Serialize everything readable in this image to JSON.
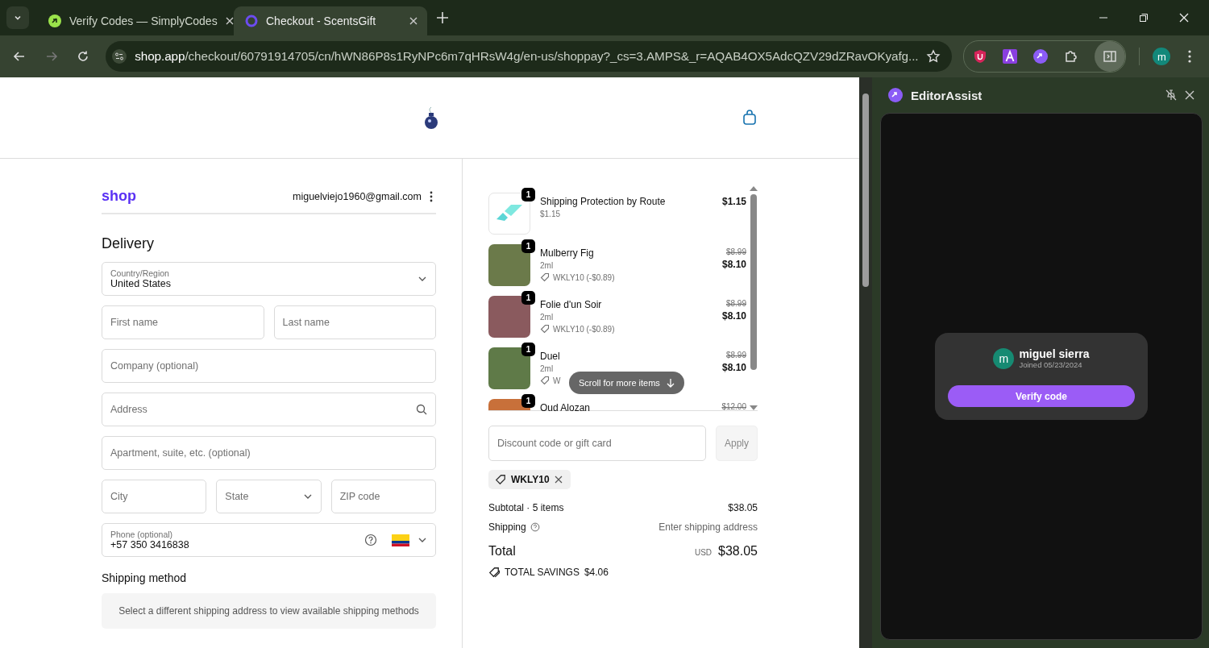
{
  "browser": {
    "tabs": [
      {
        "title": "Verify Codes — SimplyCodes",
        "selected": false
      },
      {
        "title": "Checkout - ScentsGift",
        "selected": true
      }
    ],
    "address": {
      "domain": "shop.app",
      "path": "/checkout/60791914705/cn/hWN86P8s1RyNPc6m7qHRsW4g/en-us/shoppay?_cs=3.AMPS&_r=AQAB4OX5AdcQZV29dZRavOKyafg..."
    },
    "profile_initial": "m"
  },
  "account": {
    "brand": "shop",
    "email": "miguelviejo1960@gmail.com"
  },
  "delivery": {
    "title": "Delivery",
    "rows": [
      [
        {
          "kind": "select",
          "label": "Country/Region",
          "value": "United States"
        }
      ],
      [
        {
          "kind": "text",
          "placeholder": "First name"
        },
        {
          "kind": "text",
          "placeholder": "Last name"
        }
      ],
      [
        {
          "kind": "text",
          "placeholder": "Company (optional)"
        }
      ],
      [
        {
          "kind": "search",
          "placeholder": "Address"
        }
      ],
      [
        {
          "kind": "text",
          "placeholder": "Apartment, suite, etc. (optional)"
        }
      ],
      [
        {
          "kind": "text",
          "placeholder": "City"
        },
        {
          "kind": "dropdown",
          "placeholder": "State"
        },
        {
          "kind": "text",
          "placeholder": "ZIP code"
        }
      ],
      [
        {
          "kind": "phone",
          "label": "Phone (optional)",
          "value": "+57 350 3416838"
        }
      ]
    ],
    "shipping_method": {
      "title": "Shipping method",
      "message": "Select a different shipping address to view available shipping methods"
    }
  },
  "cart": {
    "items": [
      {
        "kind": "route",
        "quantity": "1",
        "name": "Shipping Protection by Route",
        "subtitle": "$1.15",
        "price": "$1.15"
      },
      {
        "kind": "product",
        "quantity": "1",
        "name": "Mulberry Fig",
        "subtitle": "2ml",
        "discount": "WKLY10 (-$0.89)",
        "old_price": "$8.99",
        "price": "$8.10",
        "color": "#6b7a4a"
      },
      {
        "kind": "product",
        "quantity": "1",
        "name": "Folie d'un Soir",
        "subtitle": "2ml",
        "discount": "WKLY10 (-$0.89)",
        "old_price": "$8.99",
        "price": "$8.10",
        "color": "#8a5a5e"
      },
      {
        "kind": "product",
        "quantity": "1",
        "name": "Duel",
        "subtitle": "2ml",
        "discount": "W",
        "old_price": "$8.99",
        "price": "$8.10",
        "color": "#5f7a48"
      },
      {
        "kind": "product",
        "quantity": "1",
        "name": "Oud Alozan",
        "old_price": "$12.00",
        "color": "#c8703a"
      }
    ],
    "scroll_hint": "Scroll for more items",
    "discount_field": {
      "placeholder": "Discount code or gift card",
      "button": "Apply"
    },
    "applied_code": "WKLY10",
    "subtotal": {
      "label": "Subtotal · 5 items",
      "value": "$38.05"
    },
    "shipping": {
      "label": "Shipping",
      "value": "Enter shipping address"
    },
    "total": {
      "label": "Total",
      "currency": "USD",
      "value": "$38.05"
    },
    "savings": {
      "label": "TOTAL SAVINGS",
      "value": "$4.06"
    }
  },
  "side_panel": {
    "title": "EditorAssist",
    "user": {
      "initial": "m",
      "name": "miguel sierra",
      "joined": "Joined 05/23/2024"
    },
    "button": "Verify code"
  }
}
